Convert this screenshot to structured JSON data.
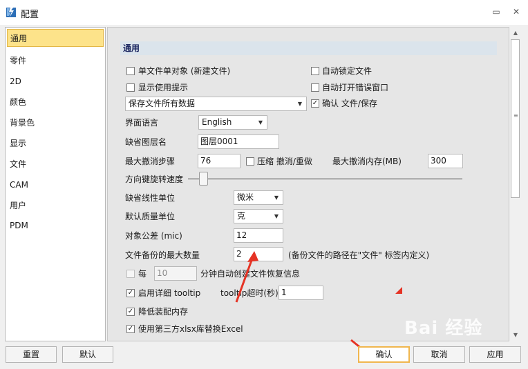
{
  "window": {
    "title": "配置",
    "buttons": {
      "help": "▭",
      "close": "✕"
    }
  },
  "sidebar": {
    "items": [
      {
        "label": "通用",
        "selected": true
      },
      {
        "label": "零件"
      },
      {
        "label": "2D"
      },
      {
        "label": "颜色"
      },
      {
        "label": "背景色"
      },
      {
        "label": "显示"
      },
      {
        "label": "文件"
      },
      {
        "label": "CAM"
      },
      {
        "label": "用户"
      },
      {
        "label": "PDM"
      }
    ]
  },
  "panel": {
    "section_title": "通用",
    "single_file_object": {
      "label": "单文件单对象 (新建文件)",
      "checked": false
    },
    "auto_lock_file": {
      "label": "自动锁定文件",
      "checked": false
    },
    "show_tips": {
      "label": "显示使用提示",
      "checked": false
    },
    "auto_open_error_window": {
      "label": "自动打开错误窗口",
      "checked": false
    },
    "save_mode_select": {
      "value": "保存文件所有数据"
    },
    "confirm_file_save": {
      "label": "确认 文件/保存",
      "checked": true
    },
    "ui_language": {
      "label": "界面语言",
      "value": "English"
    },
    "default_layer": {
      "label": "缺省图层名",
      "value": "图层0001"
    },
    "max_undo_steps": {
      "label": "最大撤消步骤",
      "value": "76"
    },
    "compress_undo": {
      "label": "压缩 撤消/重做",
      "checked": false
    },
    "max_undo_memory": {
      "label": "最大撤消内存(MB)",
      "value": "300"
    },
    "arrow_rotation_speed": {
      "label": "方向键旋转速度",
      "level": 0.05
    },
    "default_linear_unit": {
      "label": "缺省线性单位",
      "value": "微米"
    },
    "default_mass_unit": {
      "label": "默认质量单位",
      "value": "克"
    },
    "object_tolerance": {
      "label": "对象公差 (mic)",
      "value": "12"
    },
    "max_backups": {
      "label": "文件备份的最大数量",
      "value": "2",
      "note": "(备份文件的路径在\"文件\" 标签内定义)"
    },
    "autosave": {
      "prefix": "每",
      "value": "10",
      "suffix": "分钟自动创建文件恢复信息",
      "checked": false
    },
    "detailed_tooltip": {
      "label": "启用详细 tooltip",
      "checked": true
    },
    "tooltip_timeout": {
      "label": "tooltip超时(秒)",
      "value": "1"
    },
    "reduce_assembly_memory": {
      "label": "降低装配内存",
      "checked": true
    },
    "third_party_xlsx": {
      "label": "使用第三方xlsx库替换Excel",
      "checked": true
    }
  },
  "footer": {
    "reset": "重置",
    "default": "默认",
    "ok": "确认",
    "cancel": "取消",
    "apply": "应用"
  },
  "watermark": "Bai 经验",
  "colors": {
    "selected_bg": "#fde38a",
    "section_header_bg": "#dbe4ec",
    "primary_border": "#f0b64e",
    "annotation_red": "#e53324"
  }
}
